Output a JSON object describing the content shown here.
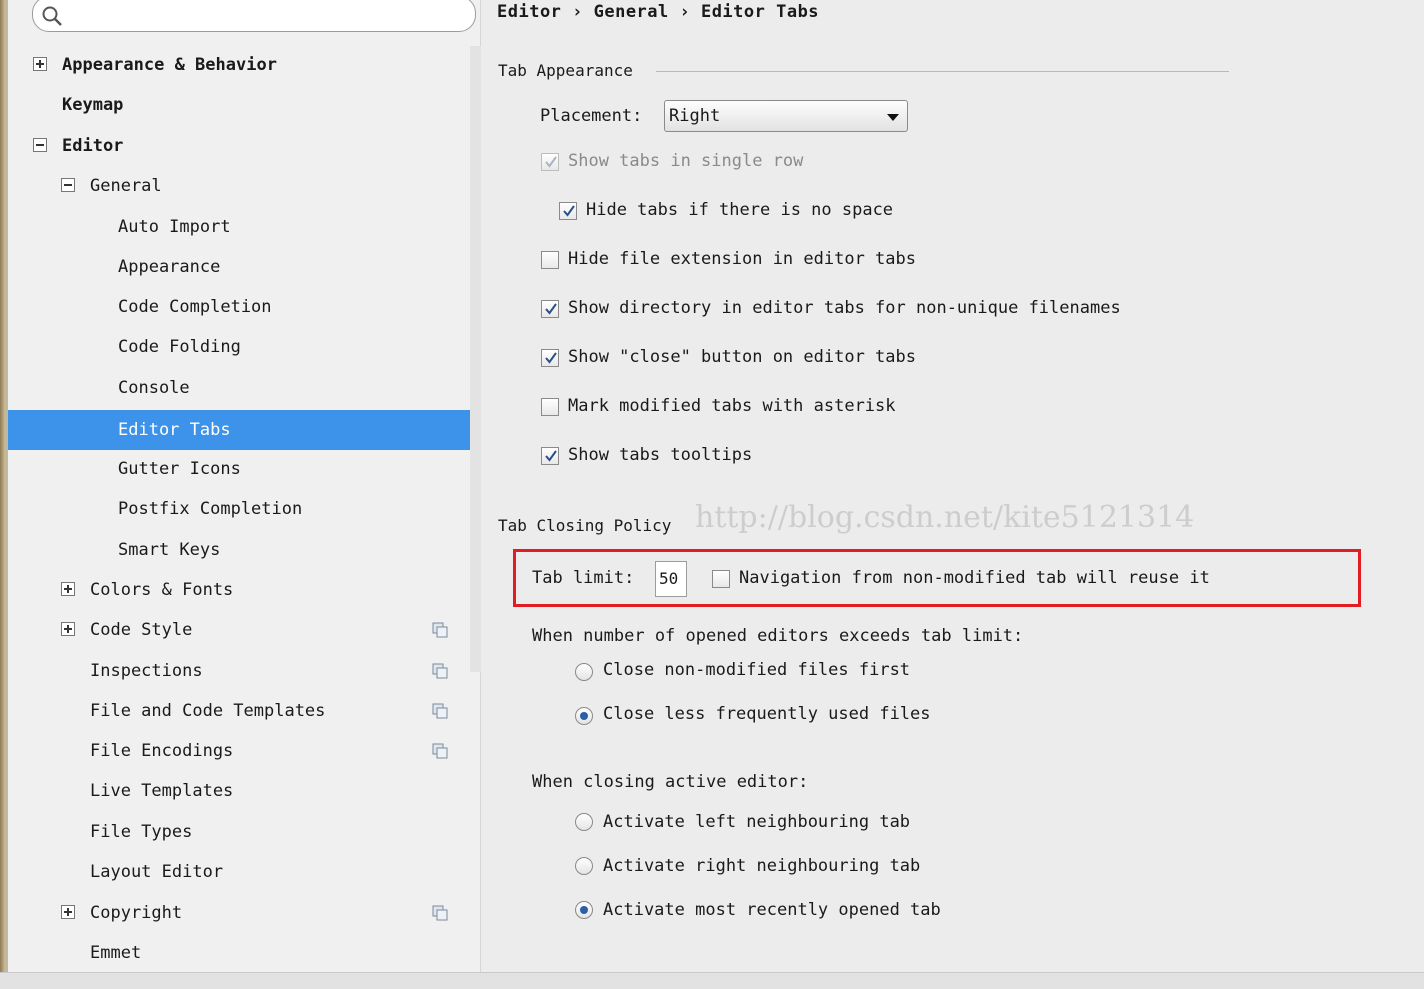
{
  "search": {
    "placeholder": ""
  },
  "breadcrumb": "Editor › General › Editor Tabs",
  "sidebar": {
    "items": [
      {
        "label": "Appearance & Behavior"
      },
      {
        "label": "Keymap"
      },
      {
        "label": "Editor"
      },
      {
        "label": "General"
      },
      {
        "label": "Auto Import"
      },
      {
        "label": "Appearance"
      },
      {
        "label": "Code Completion"
      },
      {
        "label": "Code Folding"
      },
      {
        "label": "Console"
      },
      {
        "label": "Editor Tabs"
      },
      {
        "label": "Gutter Icons"
      },
      {
        "label": "Postfix Completion"
      },
      {
        "label": "Smart Keys"
      },
      {
        "label": "Colors & Fonts"
      },
      {
        "label": "Code Style"
      },
      {
        "label": "Inspections"
      },
      {
        "label": "File and Code Templates"
      },
      {
        "label": "File Encodings"
      },
      {
        "label": "Live Templates"
      },
      {
        "label": "File Types"
      },
      {
        "label": "Layout Editor"
      },
      {
        "label": "Copyright"
      },
      {
        "label": "Emmet"
      }
    ]
  },
  "tab_appearance": {
    "title": "Tab Appearance",
    "placement_label": "Placement:",
    "placement_value": "Right",
    "options": [
      {
        "label": "Show tabs in single row",
        "checked": true
      },
      {
        "label": "Hide tabs if there is no space",
        "checked": true
      },
      {
        "label": "Hide file extension in editor tabs",
        "checked": false
      },
      {
        "label": "Show directory in editor tabs for non-unique filenames",
        "checked": true
      },
      {
        "label": "Show \"close\" button on editor tabs",
        "checked": true
      },
      {
        "label": "Mark modified tabs with asterisk",
        "checked": false
      },
      {
        "label": "Show tabs tooltips",
        "checked": true
      }
    ]
  },
  "tab_closing": {
    "title": "Tab Closing Policy",
    "tab_limit_label": "Tab limit:",
    "tab_limit_value": "50",
    "navigation_label": "Navigation from non-modified tab will reuse it",
    "navigation_checked": false,
    "exceeds_label": "When number of opened editors exceeds tab limit:",
    "exceeds_options": [
      {
        "label": "Close non-modified files first",
        "selected": false
      },
      {
        "label": "Close less frequently used files",
        "selected": true
      }
    ],
    "closing_label": "When closing active editor:",
    "closing_options": [
      {
        "label": "Activate left neighbouring tab",
        "selected": false
      },
      {
        "label": "Activate right neighbouring tab",
        "selected": false
      },
      {
        "label": "Activate most recently opened tab",
        "selected": true
      }
    ]
  },
  "watermark": "http://blog.csdn.net/kite5121314",
  "colors": {
    "selection": "#3d92ea",
    "highlight_border": "#e31c24"
  }
}
